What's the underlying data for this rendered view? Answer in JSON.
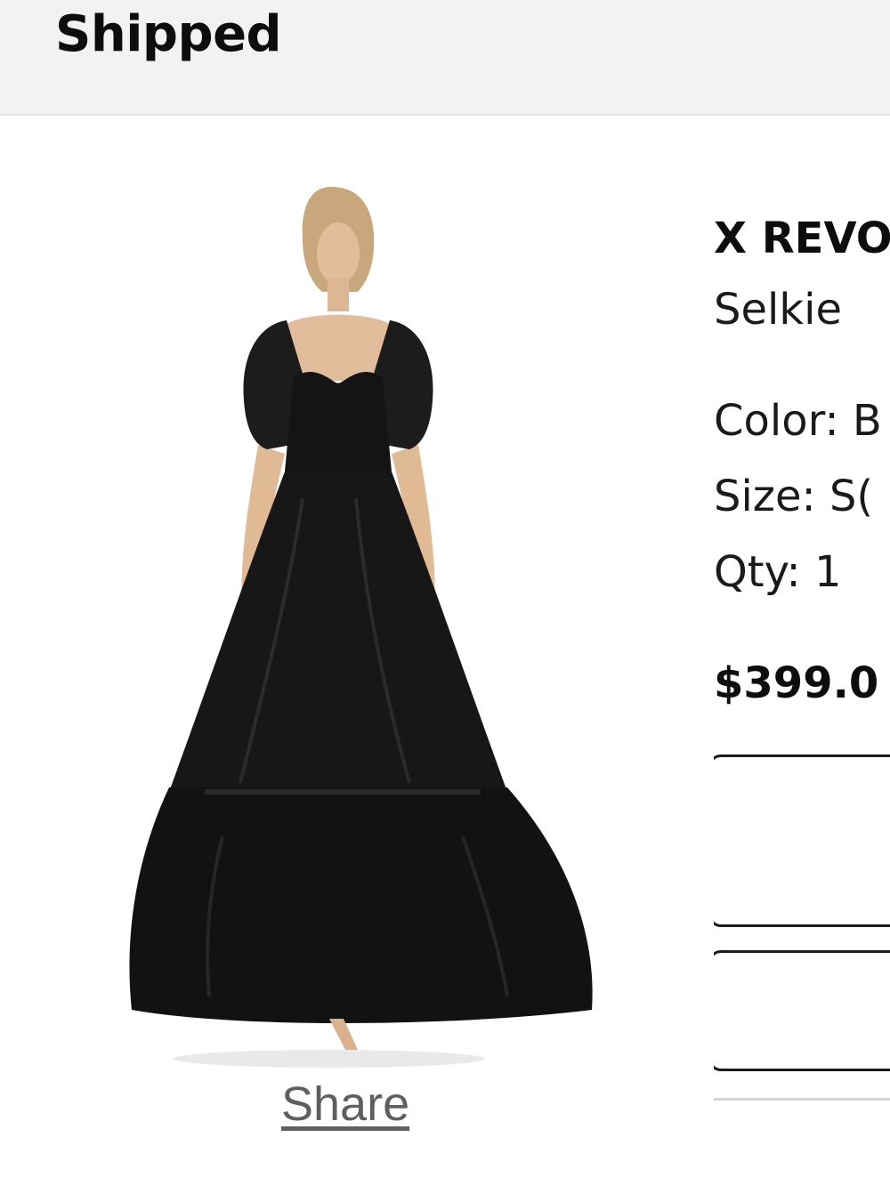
{
  "header": {
    "status": "Shipped"
  },
  "product": {
    "brand": "X REVO",
    "name": "Selkie",
    "color_text": "Color: B",
    "size_text": "Size: S(",
    "qty_text": "Qty: 1",
    "price": "$399.0",
    "share_label": "Share"
  },
  "colors": {
    "header_bg": "#f2f2f2",
    "dress": "#151515",
    "share_link": "#5f5f5f"
  }
}
